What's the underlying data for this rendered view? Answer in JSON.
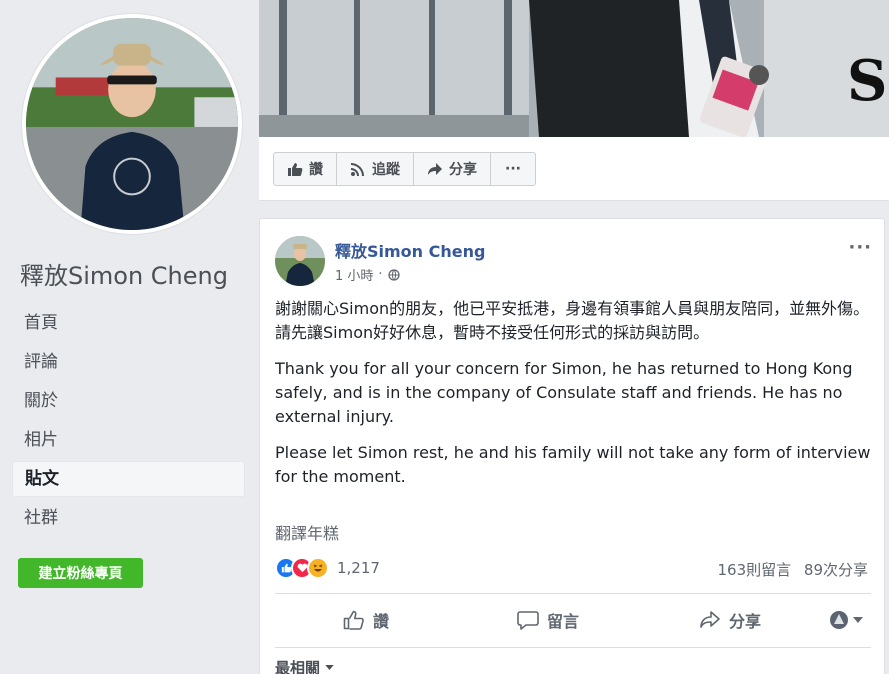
{
  "page": {
    "name": "釋放Simon Cheng",
    "create_button": "建立粉絲專頁"
  },
  "nav": {
    "items": [
      {
        "label": "首頁"
      },
      {
        "label": "評論"
      },
      {
        "label": "關於"
      },
      {
        "label": "相片"
      },
      {
        "label": "貼文"
      },
      {
        "label": "社群"
      }
    ],
    "active_index": 4
  },
  "action_bar": {
    "like": "讚",
    "follow": "追蹤",
    "share": "分享",
    "more": "···"
  },
  "post": {
    "author": "釋放Simon Cheng",
    "time": "1 小時",
    "more": "···",
    "paragraphs": [
      "謝謝關心Simon的朋友，他已平安抵港，身邊有領事館人員與朋友陪同，並無外傷。",
      "請先讓Simon好好休息，暫時不接受任何形式的採訪與訪問。",
      "Thank you for all your concern for Simon, he has returned to Hong Kong safely, and is in the company of Consulate staff and friends. He has no external injury.",
      "Please let Simon rest, he and his family will not take any form of interview for the moment."
    ],
    "translate": "翻譯年糕",
    "reaction_count": "1,217",
    "comments": "163則留言",
    "shares": "89次分享",
    "actions": {
      "like": "讚",
      "comment": "留言",
      "share": "分享"
    },
    "sort": "最相關"
  },
  "colors": {
    "link": "#365899",
    "green": "#42b72a",
    "like_blue": "#1877f2",
    "love_red": "#f0284a",
    "haha_yellow": "#f7b125"
  }
}
